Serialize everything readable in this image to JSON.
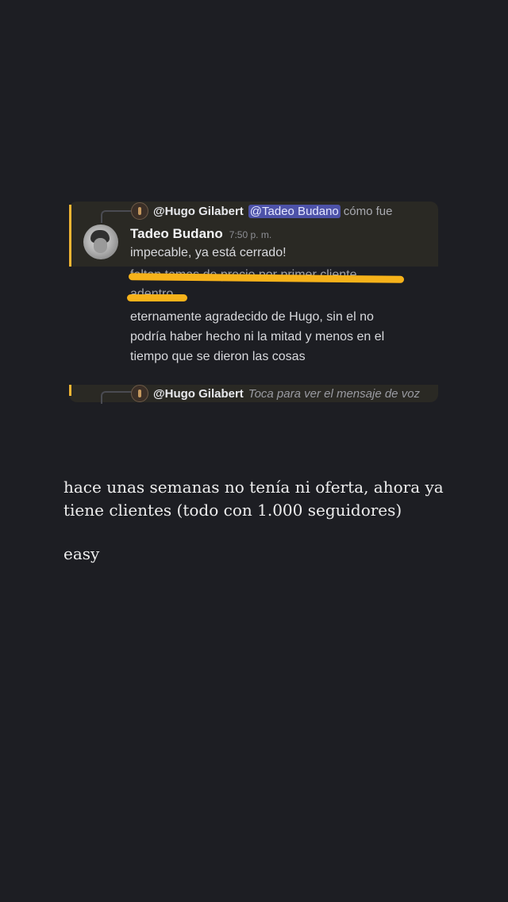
{
  "message_card": {
    "reply_to_top": {
      "user": "@Hugo Gilabert",
      "mention": "@Tadeo Budano",
      "text": "cómo fue"
    },
    "author": {
      "name": "Tadeo Budano",
      "time": "7:50 p. m.",
      "avatar_icon": "profile-photo"
    },
    "lines": {
      "line1": "impecable, ya está cerrado!",
      "struck1": "faltan temas de precio por primer cliente",
      "struck2": "adentro",
      "body1": "eternamente agradecido de Hugo, sin el no",
      "body2": "podría haber hecho ni la mitad y menos en el",
      "body3": "tiempo que se dieron las cosas"
    },
    "reply_to_bottom": {
      "user": "@Hugo Gilabert",
      "text": "Toca para ver el mensaje de voz"
    },
    "colors": {
      "accent": "#f2b533",
      "scribble": "#f6b21a",
      "mention_bg": "#4d52a8"
    }
  },
  "story_text": {
    "line1": "hace unas semanas no tenía ni oferta, ahora ya",
    "line2": "tiene clientes (todo con 1.000 seguidores)",
    "line3": "easy"
  }
}
